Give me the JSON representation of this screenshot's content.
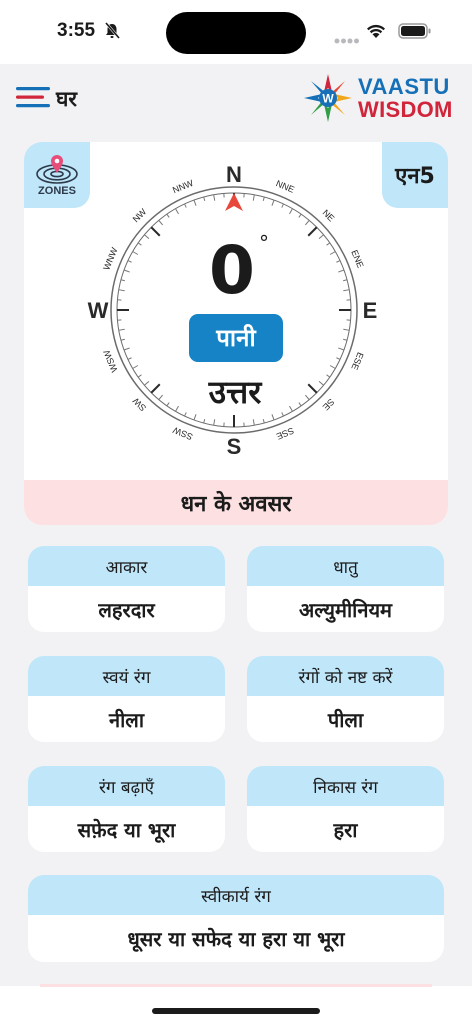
{
  "status_bar": {
    "time": "3:55",
    "icons": [
      "bell-slash-icon",
      "signal-dots-icon",
      "wifi-icon",
      "battery-icon"
    ]
  },
  "nav": {
    "menu_label": "घर",
    "menu_icon": "hamburger-menu-icon",
    "logo_line1": "VAASTU",
    "logo_line2": "WISDOM"
  },
  "compass": {
    "zones_label": "ZONES",
    "zone_code": "एन5",
    "degree": "0",
    "degree_symbol": "°",
    "element": "पानी",
    "direction": "उत्तर",
    "footer": "धन के अवसर",
    "cardinal": {
      "N": "N",
      "E": "E",
      "S": "S",
      "W": "W"
    },
    "intercardinal": [
      "NNE",
      "NE",
      "ENE",
      "ESE",
      "SE",
      "SSE",
      "SSW",
      "SW",
      "WSW",
      "WNW",
      "NW",
      "NNW"
    ],
    "heading_deg": 0,
    "colors": {
      "element_bg": "#1583c6",
      "marker": "#e8483b"
    }
  },
  "cards": [
    {
      "head": "आकार",
      "value": "लहरदार"
    },
    {
      "head": "धातु",
      "value": "अल्युमीनियम"
    },
    {
      "head": "स्वयं रंग",
      "value": "नीला"
    },
    {
      "head": "रंगों को नष्ट करें",
      "value": "पीला"
    },
    {
      "head": "रंग बढ़ाएँ",
      "value": "सफ़ेद या भूरा"
    },
    {
      "head": "निकास रंग",
      "value": "हरा"
    },
    {
      "head": "स्वीकार्य रंग",
      "value": "धूसर या सफेद या हरा या भूरा"
    }
  ]
}
